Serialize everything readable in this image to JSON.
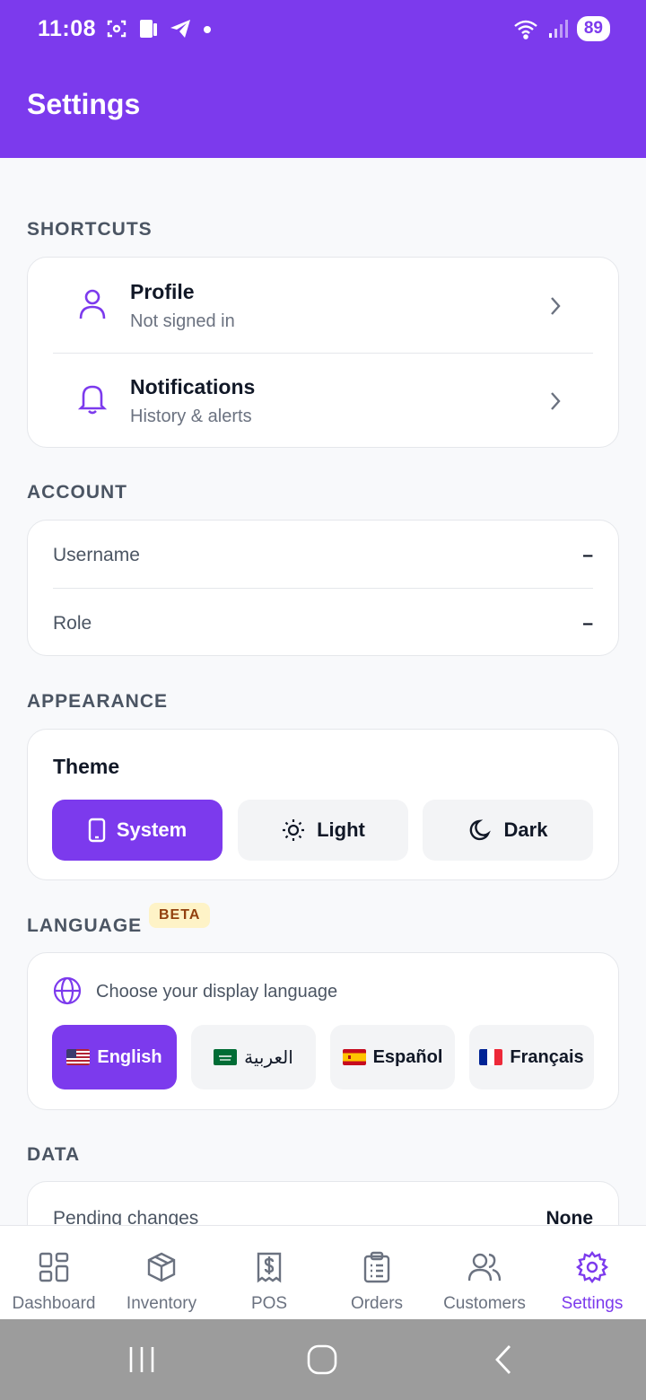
{
  "status_bar": {
    "time": "11:08",
    "battery": "89"
  },
  "header": {
    "title": "Settings"
  },
  "shortcuts": {
    "label": "SHORTCUTS",
    "items": [
      {
        "title": "Profile",
        "subtitle": "Not signed in",
        "icon": "user-icon"
      },
      {
        "title": "Notifications",
        "subtitle": "History & alerts",
        "icon": "bell-icon"
      }
    ]
  },
  "account": {
    "label": "ACCOUNT",
    "rows": [
      {
        "label": "Username",
        "value": "–"
      },
      {
        "label": "Role",
        "value": "–"
      }
    ]
  },
  "appearance": {
    "label": "APPEARANCE",
    "theme_title": "Theme",
    "options": [
      {
        "label": "System",
        "icon": "phone-icon",
        "active": true
      },
      {
        "label": "Light",
        "icon": "sun-icon",
        "active": false
      },
      {
        "label": "Dark",
        "icon": "moon-icon",
        "active": false
      }
    ]
  },
  "language": {
    "label": "LANGUAGE",
    "badge": "BETA",
    "hint": "Choose your display language",
    "options": [
      {
        "label": "English",
        "flag": "us-flag",
        "active": true
      },
      {
        "label": "العربية",
        "flag": "saudi-flag",
        "active": false
      },
      {
        "label": "Español",
        "flag": "spain-flag",
        "active": false
      },
      {
        "label": "Français",
        "flag": "france-flag",
        "active": false
      }
    ]
  },
  "data_section": {
    "label": "DATA",
    "rows": [
      {
        "label": "Pending changes",
        "value": "None"
      }
    ]
  },
  "bottom_nav": {
    "items": [
      {
        "label": "Dashboard",
        "icon": "dashboard-icon"
      },
      {
        "label": "Inventory",
        "icon": "box-icon"
      },
      {
        "label": "POS",
        "icon": "receipt-icon"
      },
      {
        "label": "Orders",
        "icon": "clipboard-icon"
      },
      {
        "label": "Customers",
        "icon": "users-icon"
      },
      {
        "label": "Settings",
        "icon": "gear-icon",
        "active": true
      }
    ]
  },
  "colors": {
    "accent": "#7c3aed",
    "background": "#f8f9fb",
    "card": "#ffffff",
    "beta_bg": "#fef3c7",
    "beta_text": "#92400e"
  }
}
